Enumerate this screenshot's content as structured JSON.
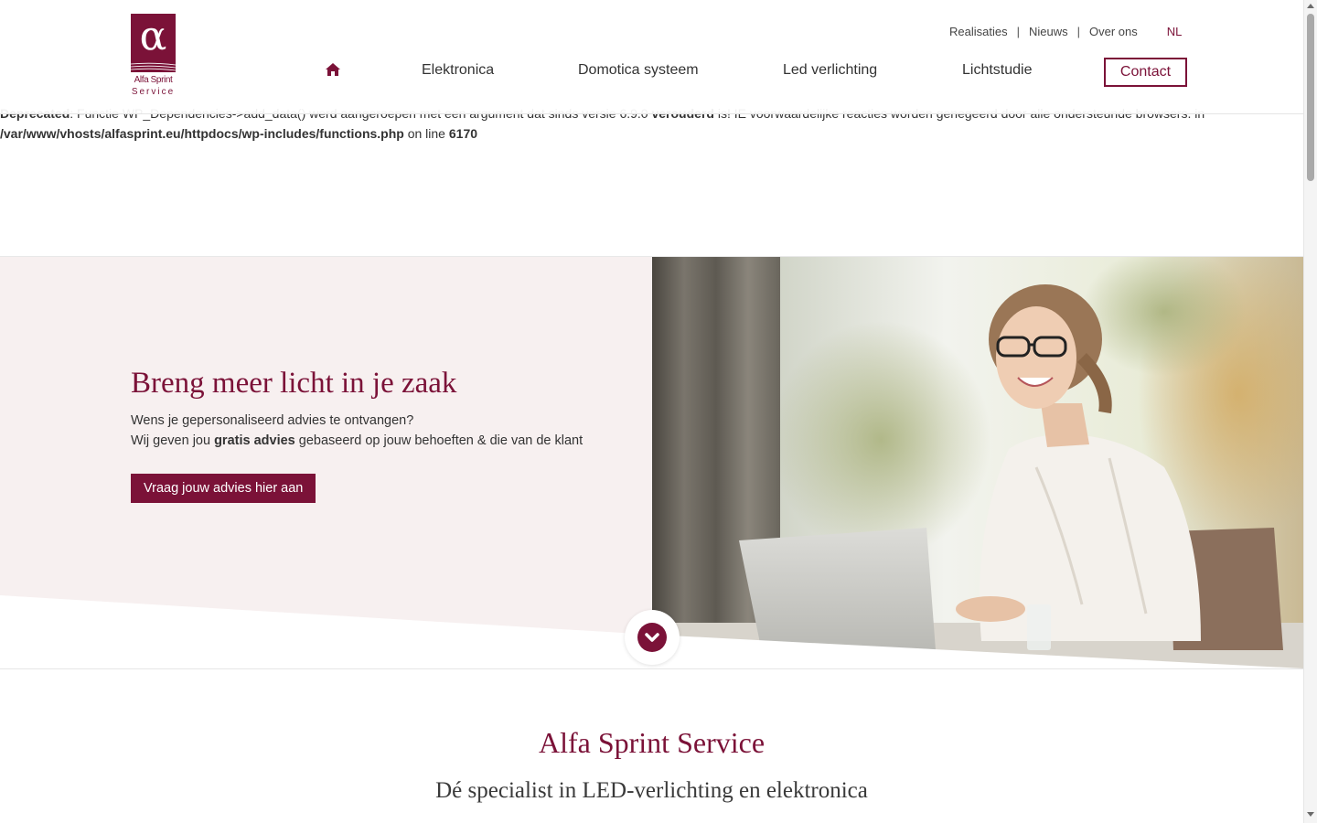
{
  "notice": {
    "line1_bold_start": "Deprecated",
    "line1_mid": ": Functie WP_Dependencies->add_data() werd aangeroepen met een argument dat sinds versie 6.9.0 ",
    "line1_bold_mid": "verouderd",
    "line1_end": " is! IE voorwaardelijke reacties worden genegeerd door alle ondersteunde browsers. in",
    "path": "/var/www/vhosts/alfasprint.eu/httpdocs/wp-includes/functions.php",
    "on_line": " on line ",
    "line_number": "6170"
  },
  "logo": {
    "symbol": "α",
    "line1": "Alfa Sprint",
    "line2": "Service"
  },
  "topnav": {
    "items": [
      "Realisaties",
      "Nieuws",
      "Over ons"
    ],
    "separator": "|",
    "language": "NL"
  },
  "mainnav": {
    "home_icon": "home-icon",
    "items": [
      "Elektronica",
      "Domotica systeem",
      "Led verlichting",
      "Lichtstudie"
    ],
    "contact": "Contact"
  },
  "hero": {
    "title": "Breng meer licht in je zaak",
    "line1": "Wens je gepersonaliseerd advies te ontvangen?",
    "line2_start": "Wij geven jou ",
    "line2_bold": "gratis advies",
    "line2_end": " gebaseerd op jouw behoeften & die van de klant",
    "button": "Vraag jouw advies hier aan",
    "scroll_icon": "chevron-down-icon"
  },
  "intro": {
    "title": "Alfa Sprint Service",
    "subtitle": "Dé specialist in LED-verlichting en elektronica"
  },
  "colors": {
    "brand": "#7b1238",
    "hero_bg": "#f7f0f0"
  }
}
